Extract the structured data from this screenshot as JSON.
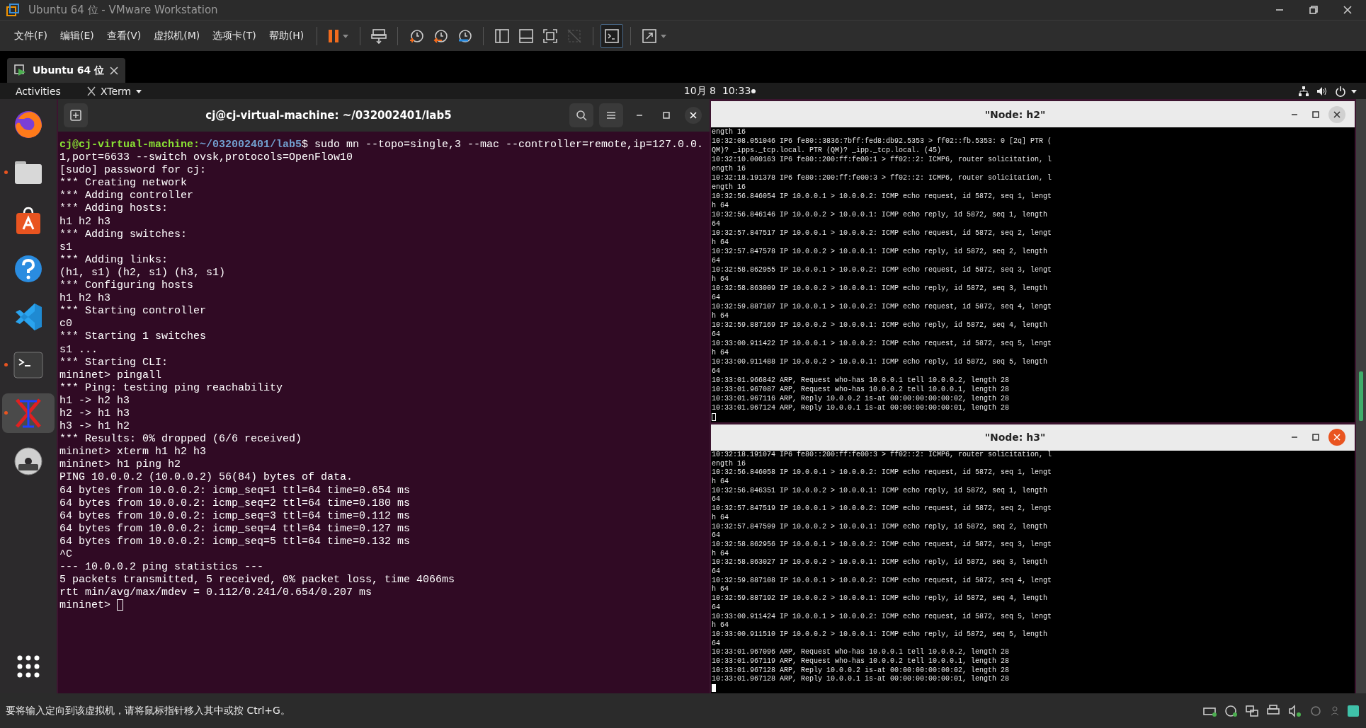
{
  "window": {
    "title": "Ubuntu 64 位 - VMware Workstation"
  },
  "menu": [
    "文件(F)",
    "编辑(E)",
    "查看(V)",
    "虚拟机(M)",
    "选项卡(T)",
    "帮助(H)"
  ],
  "vm_tab": {
    "label": "Ubuntu 64 位",
    "selected": true
  },
  "topbar": {
    "activities": "Activities",
    "app": "XTerm",
    "date": "10月 8",
    "time": "10:33"
  },
  "dock": [
    {
      "kind": "browser",
      "running": false,
      "selected": false
    },
    {
      "kind": "files",
      "running": true,
      "selected": false
    },
    {
      "kind": "store",
      "running": false,
      "selected": false
    },
    {
      "kind": "help",
      "running": false,
      "selected": false
    },
    {
      "kind": "code",
      "running": false,
      "selected": false
    },
    {
      "kind": "terminal",
      "running": true,
      "selected": false
    },
    {
      "kind": "xterm",
      "running": true,
      "selected": true
    },
    {
      "kind": "disc",
      "running": false,
      "selected": false
    }
  ],
  "terminal": {
    "title": "cj@cj-virtual-machine: ~/032002401/lab5",
    "prompt": {
      "user_host": "cj@cj-virtual-machine:",
      "path": "~/032002401/lab5",
      "command": "$ sudo mn --topo=single,3 --mac --controller=remote,ip=127.0.0."
    },
    "lines": [
      "1,port=6633 --switch ovsk,protocols=OpenFlow10",
      "[sudo] password for cj:",
      "*** Creating network",
      "*** Adding controller",
      "*** Adding hosts:",
      "h1 h2 h3",
      "*** Adding switches:",
      "s1",
      "*** Adding links:",
      "(h1, s1) (h2, s1) (h3, s1)",
      "*** Configuring hosts",
      "h1 h2 h3",
      "*** Starting controller",
      "c0",
      "*** Starting 1 switches",
      "s1 ...",
      "*** Starting CLI:",
      "mininet> pingall",
      "*** Ping: testing ping reachability",
      "h1 -> h2 h3",
      "h2 -> h1 h3",
      "h3 -> h1 h2",
      "*** Results: 0% dropped (6/6 received)",
      "mininet> xterm h1 h2 h3",
      "mininet> h1 ping h2",
      "PING 10.0.0.2 (10.0.0.2) 56(84) bytes of data.",
      "64 bytes from 10.0.0.2: icmp_seq=1 ttl=64 time=0.654 ms",
      "64 bytes from 10.0.0.2: icmp_seq=2 ttl=64 time=0.180 ms",
      "64 bytes from 10.0.0.2: icmp_seq=3 ttl=64 time=0.112 ms",
      "64 bytes from 10.0.0.2: icmp_seq=4 ttl=64 time=0.127 ms",
      "64 bytes from 10.0.0.2: icmp_seq=5 ttl=64 time=0.132 ms",
      "^C",
      "--- 10.0.0.2 ping statistics ---",
      "5 packets transmitted, 5 received, 0% packet loss, time 4066ms",
      "rtt min/avg/max/mdev = 0.112/0.241/0.654/0.207 ms"
    ],
    "cursor_prompt": "mininet>"
  },
  "xterms": [
    {
      "title": "\"Node: h2\"",
      "focused": false,
      "lines": [
        "ength 16",
        "10:32:08.051046 IP6 fe80::3836:7bff:fed8:db92.5353 > ff02::fb.5353: 0 [2q] PTR (",
        "QM)? _ipps._tcp.local. PTR (QM)? _ipp._tcp.local. (45)",
        "10:32:10.000163 IP6 fe80::200:ff:fe00:1 > ff02::2: ICMP6, router solicitation, l",
        "ength 16",
        "10:32:18.191378 IP6 fe80::200:ff:fe00:3 > ff02::2: ICMP6, router solicitation, l",
        "ength 16",
        "10:32:56.846054 IP 10.0.0.1 > 10.0.0.2: ICMP echo request, id 5872, seq 1, lengt",
        "h 64",
        "10:32:56.846146 IP 10.0.0.2 > 10.0.0.1: ICMP echo reply, id 5872, seq 1, length",
        "64",
        "10:32:57.847517 IP 10.0.0.1 > 10.0.0.2: ICMP echo request, id 5872, seq 2, lengt",
        "h 64",
        "10:32:57.847578 IP 10.0.0.2 > 10.0.0.1: ICMP echo reply, id 5872, seq 2, length",
        "64",
        "10:32:58.862955 IP 10.0.0.1 > 10.0.0.2: ICMP echo request, id 5872, seq 3, lengt",
        "h 64",
        "10:32:58.863009 IP 10.0.0.2 > 10.0.0.1: ICMP echo reply, id 5872, seq 3, length",
        "64",
        "10:32:59.887107 IP 10.0.0.1 > 10.0.0.2: ICMP echo request, id 5872, seq 4, lengt",
        "h 64",
        "10:32:59.887169 IP 10.0.0.2 > 10.0.0.1: ICMP echo reply, id 5872, seq 4, length",
        "64",
        "10:33:00.911422 IP 10.0.0.1 > 10.0.0.2: ICMP echo request, id 5872, seq 5, lengt",
        "h 64",
        "10:33:00.911488 IP 10.0.0.2 > 10.0.0.1: ICMP echo reply, id 5872, seq 5, length",
        "64",
        "10:33:01.966842 ARP, Request who-has 10.0.0.1 tell 10.0.0.2, length 28",
        "10:33:01.967087 ARP, Request who-has 10.0.0.2 tell 10.0.0.1, length 28",
        "10:33:01.967116 ARP, Reply 10.0.0.2 is-at 00:00:00:00:00:02, length 28",
        "10:33:01.967124 ARP, Reply 10.0.0.1 is-at 00:00:00:00:00:01, length 28"
      ]
    },
    {
      "title": "\"Node: h3\"",
      "focused": true,
      "lines": [
        "10:32:18.191074 IP6 fe80::200:ff:fe00:3 > ff02::2: ICMP6, router solicitation, l",
        "ength 16",
        "10:32:56.846058 IP 10.0.0.1 > 10.0.0.2: ICMP echo request, id 5872, seq 1, lengt",
        "h 64",
        "10:32:56.846351 IP 10.0.0.2 > 10.0.0.1: ICMP echo reply, id 5872, seq 1, length",
        "64",
        "10:32:57.847519 IP 10.0.0.1 > 10.0.0.2: ICMP echo request, id 5872, seq 2, lengt",
        "h 64",
        "10:32:57.847599 IP 10.0.0.2 > 10.0.0.1: ICMP echo reply, id 5872, seq 2, length",
        "64",
        "10:32:58.862956 IP 10.0.0.1 > 10.0.0.2: ICMP echo request, id 5872, seq 3, lengt",
        "h 64",
        "10:32:58.863027 IP 10.0.0.2 > 10.0.0.1: ICMP echo reply, id 5872, seq 3, length",
        "64",
        "10:32:59.887108 IP 10.0.0.1 > 10.0.0.2: ICMP echo request, id 5872, seq 4, lengt",
        "h 64",
        "10:32:59.887192 IP 10.0.0.2 > 10.0.0.1: ICMP echo reply, id 5872, seq 4, length",
        "64",
        "10:33:00.911424 IP 10.0.0.1 > 10.0.0.2: ICMP echo request, id 5872, seq 5, lengt",
        "h 64",
        "10:33:00.911510 IP 10.0.0.2 > 10.0.0.1: ICMP echo reply, id 5872, seq 5, length",
        "64",
        "10:33:01.967096 ARP, Request who-has 10.0.0.1 tell 10.0.0.2, length 28",
        "10:33:01.967119 ARP, Request who-has 10.0.0.2 tell 10.0.0.1, length 28",
        "10:33:01.967128 ARP, Reply 10.0.0.2 is-at 00:00:00:00:00:02, length 28",
        "10:33:01.967128 ARP, Reply 10.0.0.1 is-at 00:00:00:00:00:01, length 28"
      ]
    }
  ],
  "status_bar": {
    "message": "要将输入定向到该虚拟机，请将鼠标指针移入其中或按 Ctrl+G。"
  }
}
